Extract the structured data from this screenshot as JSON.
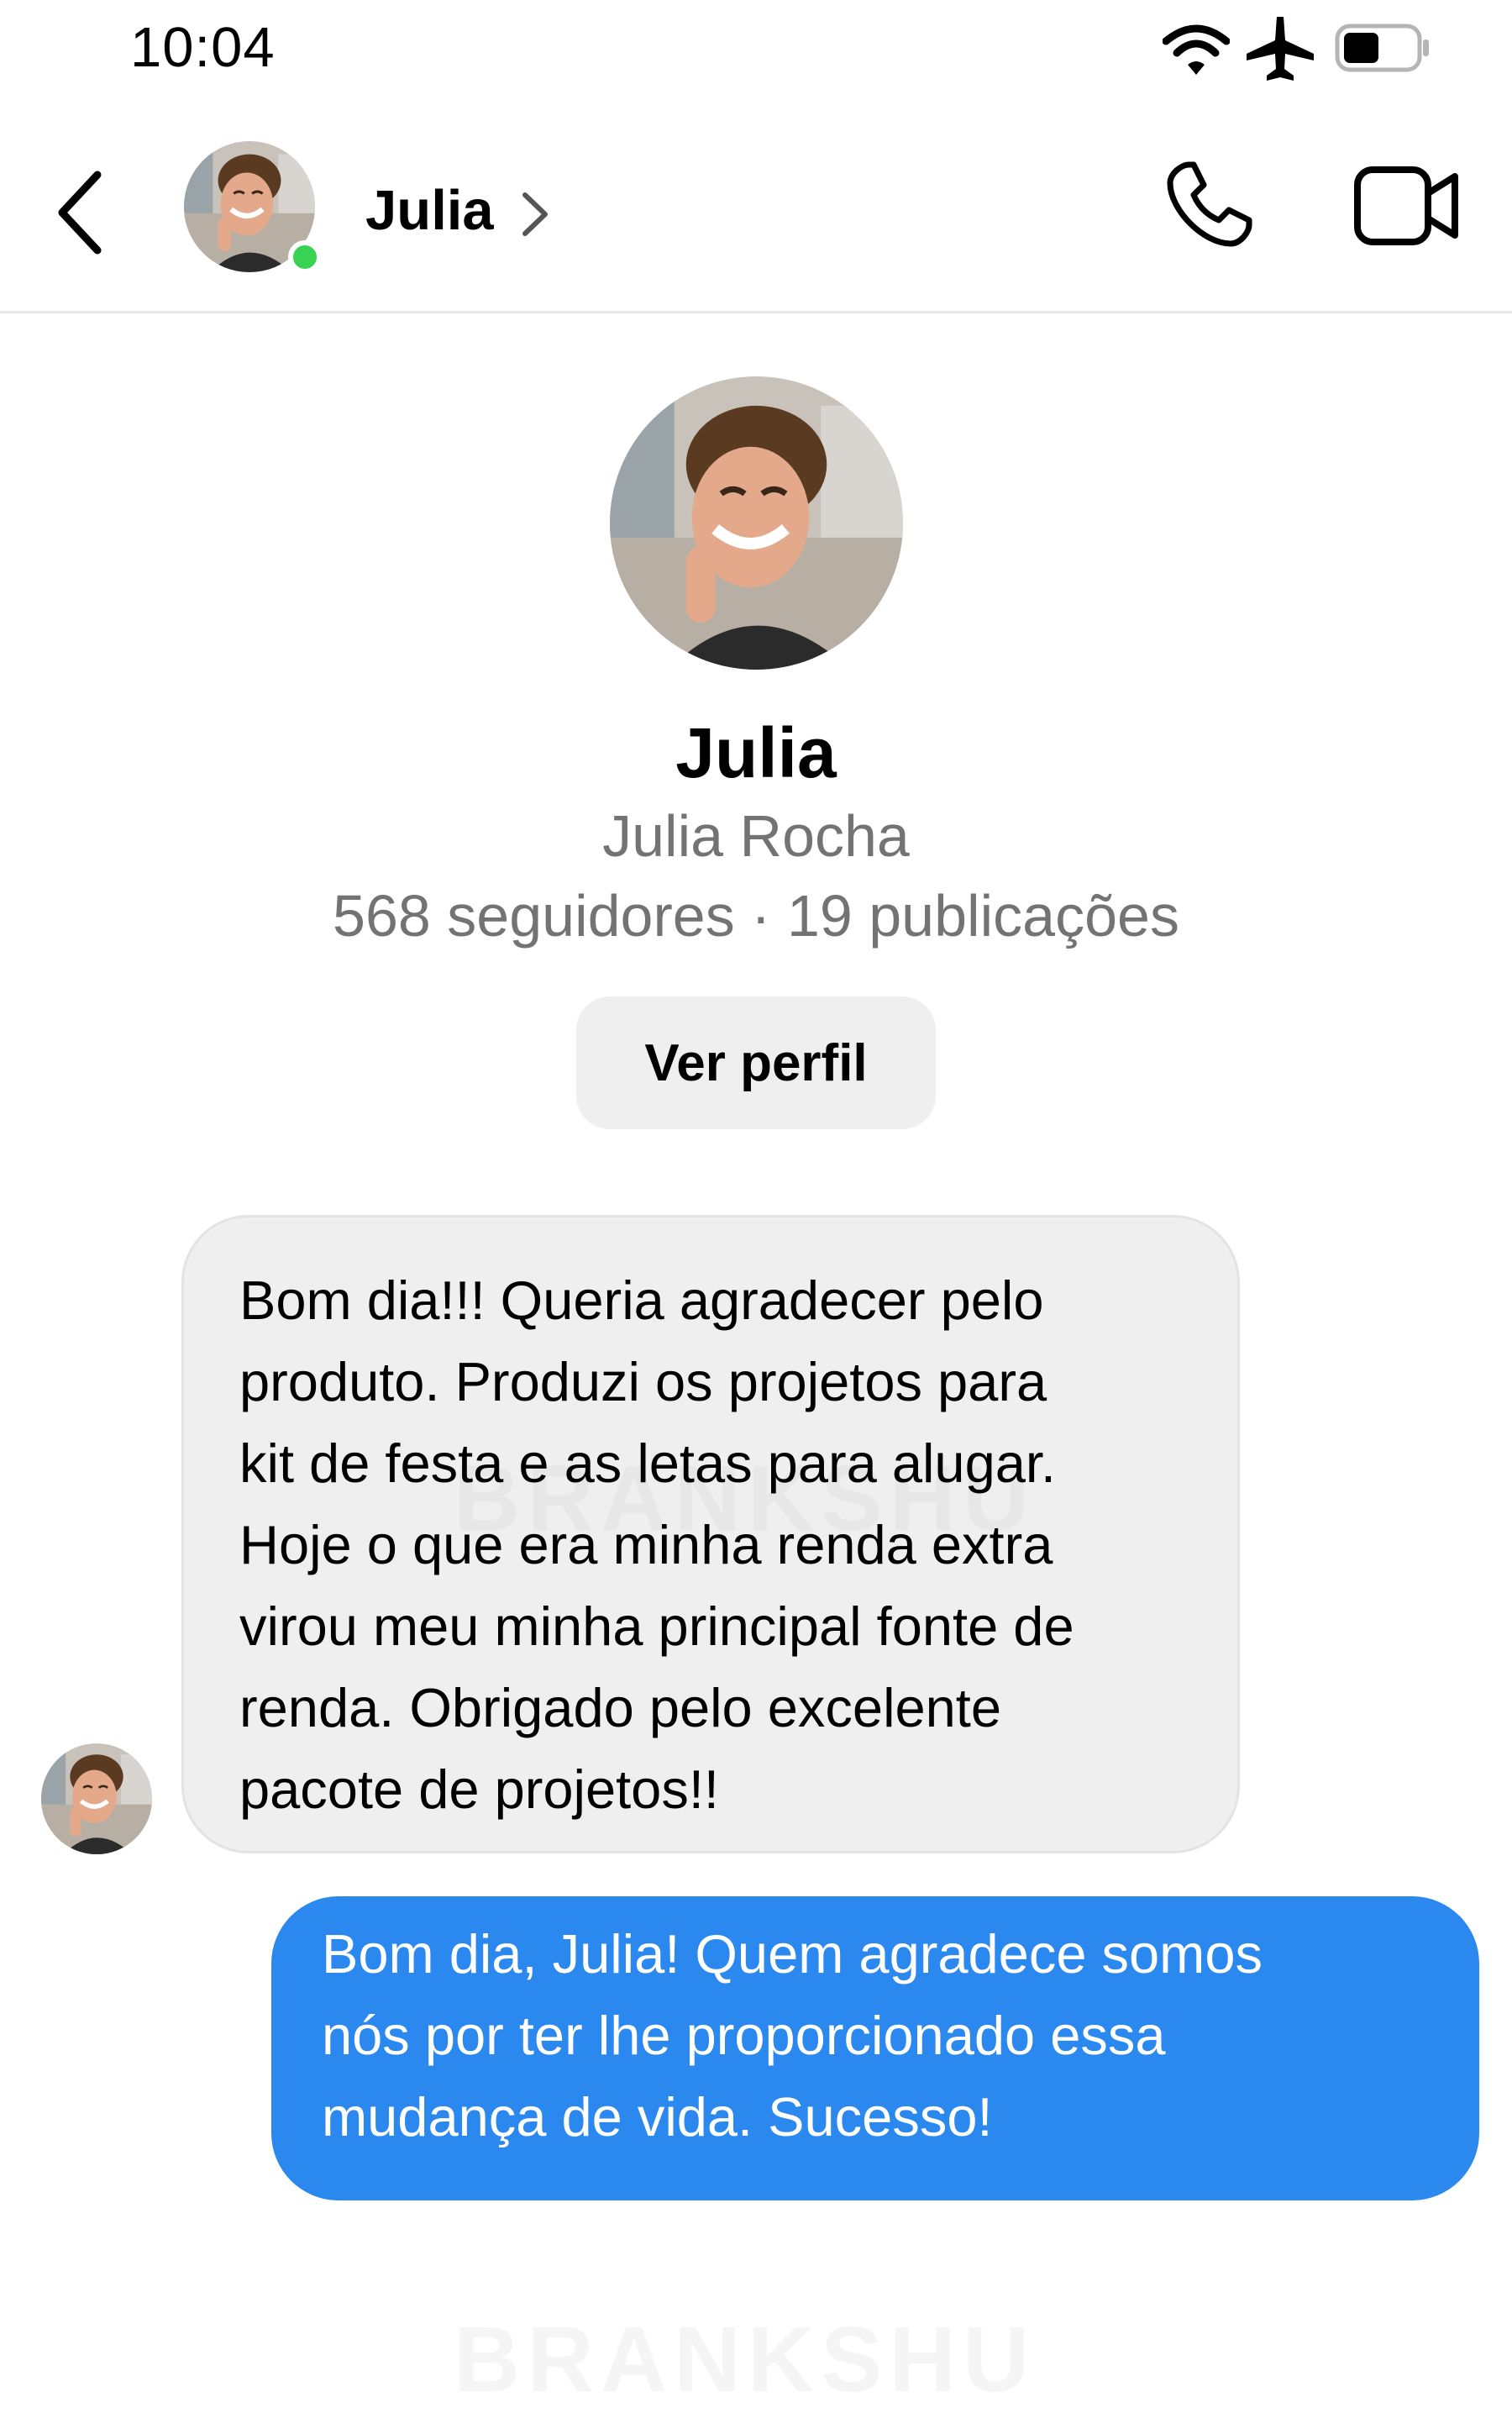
{
  "status_bar": {
    "time": "10:04",
    "icons": [
      "wifi-icon",
      "airplane-mode-icon",
      "battery-icon"
    ],
    "battery_level": 0.5
  },
  "header": {
    "contact_name": "Julia",
    "online": true,
    "icons": [
      "back-arrow-icon",
      "chevron-right-icon",
      "phone-icon",
      "video-camera-icon"
    ]
  },
  "profile": {
    "name": "Julia",
    "full_name": "Julia Rocha",
    "stats": "568 seguidores · 19 publicações",
    "view_profile_label": "Ver perfil"
  },
  "messages": [
    {
      "direction": "incoming",
      "lines": [
        "Bom dia!!! Queria agradecer pelo",
        "produto. Produzi os projetos para",
        "kit de festa e as letas para alugar.",
        "Hoje o que era minha renda extra",
        "virou meu minha principal fonte de",
        "renda. Obrigado pelo excelente",
        "pacote de projetos!!"
      ]
    },
    {
      "direction": "outgoing",
      "lines": [
        "Bom dia, Julia! Quem agradece somos",
        "nós por ter lhe proporcionado essa",
        "mudança de vida. Sucesso!"
      ]
    }
  ],
  "watermark": "BRANKSHU",
  "colors": {
    "outgoing_bubble": "#2a88ef",
    "incoming_bubble": "#efefef",
    "online_dot": "#39d353",
    "secondary_text": "#737373"
  }
}
